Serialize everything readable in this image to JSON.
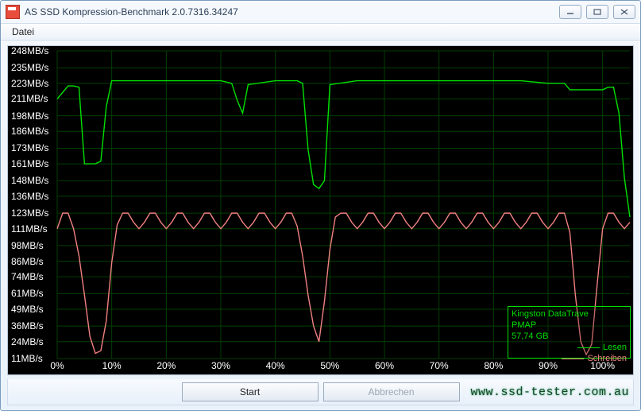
{
  "window": {
    "title": "AS SSD Kompression-Benchmark 2.0.7316.34247"
  },
  "menu": {
    "file": "Datei"
  },
  "buttons": {
    "start": "Start",
    "cancel": "Abbrechen"
  },
  "legend": {
    "device": "Kingston DataTrave",
    "device2": "PMAP",
    "capacity": "57,74 GB",
    "read": "Lesen",
    "write": "Schreiben"
  },
  "watermark": "www.ssd-tester.com.au",
  "chart_data": {
    "type": "line",
    "xlabel": "",
    "ylabel": "",
    "xlim": [
      0,
      105
    ],
    "ylim": [
      11,
      248
    ],
    "x_tick_labels": [
      "0%",
      "10%",
      "20%",
      "30%",
      "40%",
      "50%",
      "60%",
      "70%",
      "80%",
      "90%",
      "100%"
    ],
    "x_tick_values": [
      0,
      10,
      20,
      30,
      40,
      50,
      60,
      70,
      80,
      90,
      100
    ],
    "y_tick_labels": [
      "248MB/s",
      "235MB/s",
      "223MB/s",
      "211MB/s",
      "198MB/s",
      "186MB/s",
      "173MB/s",
      "161MB/s",
      "148MB/s",
      "136MB/s",
      "123MB/s",
      "111MB/s",
      "98MB/s",
      "86MB/s",
      "74MB/s",
      "61MB/s",
      "49MB/s",
      "36MB/s",
      "24MB/s",
      "11MB/s"
    ],
    "y_tick_values": [
      248,
      235,
      223,
      211,
      198,
      186,
      173,
      161,
      148,
      136,
      123,
      111,
      98,
      86,
      74,
      61,
      49,
      36,
      24,
      11
    ],
    "series": [
      {
        "name": "Lesen",
        "color": "#00e000",
        "x": [
          0,
          1,
          2,
          3,
          4,
          5,
          6,
          7,
          8,
          9,
          10,
          11,
          15,
          20,
          25,
          30,
          32,
          33,
          34,
          35,
          40,
          44,
          45,
          46,
          47,
          48,
          49,
          50,
          55,
          60,
          65,
          70,
          75,
          80,
          85,
          90,
          93,
          94,
          95,
          100,
          101,
          102,
          103,
          104,
          105
        ],
        "values": [
          211,
          216,
          221,
          221,
          220,
          161,
          161,
          161,
          163,
          205,
          225,
          225,
          225,
          225,
          225,
          225,
          223,
          210,
          200,
          222,
          225,
          225,
          223,
          172,
          145,
          142,
          148,
          222,
          225,
          225,
          225,
          225,
          225,
          225,
          225,
          223,
          223,
          218,
          218,
          218,
          220,
          220,
          200,
          150,
          120
        ]
      },
      {
        "name": "Schreiben",
        "color": "#f08080",
        "x": [
          0,
          1,
          2,
          3,
          4,
          5,
          6,
          7,
          8,
          9,
          10,
          11,
          12,
          13,
          14,
          15,
          16,
          17,
          18,
          19,
          20,
          21,
          22,
          23,
          24,
          25,
          26,
          27,
          28,
          29,
          30,
          31,
          32,
          33,
          34,
          35,
          36,
          37,
          38,
          39,
          40,
          41,
          42,
          43,
          44,
          45,
          46,
          47,
          48,
          49,
          50,
          51,
          52,
          53,
          54,
          55,
          56,
          57,
          58,
          59,
          60,
          61,
          62,
          63,
          64,
          65,
          66,
          67,
          68,
          69,
          70,
          71,
          72,
          73,
          74,
          75,
          76,
          77,
          78,
          79,
          80,
          81,
          82,
          83,
          84,
          85,
          86,
          87,
          88,
          89,
          90,
          91,
          92,
          93,
          94,
          95,
          96,
          97,
          98,
          99,
          100,
          101,
          102,
          103,
          104,
          105
        ],
        "values": [
          111,
          123,
          123,
          111,
          90,
          60,
          28,
          15,
          17,
          40,
          85,
          114,
          123,
          123,
          116,
          111,
          116,
          123,
          123,
          116,
          111,
          116,
          123,
          123,
          116,
          111,
          116,
          123,
          123,
          116,
          111,
          116,
          123,
          123,
          116,
          111,
          116,
          123,
          123,
          116,
          111,
          116,
          123,
          123,
          113,
          90,
          60,
          36,
          24,
          55,
          95,
          120,
          123,
          123,
          116,
          111,
          116,
          123,
          123,
          116,
          111,
          116,
          123,
          123,
          116,
          111,
          116,
          123,
          123,
          116,
          111,
          116,
          123,
          123,
          116,
          111,
          116,
          123,
          123,
          116,
          111,
          116,
          123,
          123,
          116,
          111,
          116,
          123,
          123,
          116,
          111,
          116,
          123,
          123,
          108,
          60,
          24,
          14,
          22,
          68,
          111,
          123,
          123,
          116,
          111,
          116
        ]
      }
    ]
  }
}
